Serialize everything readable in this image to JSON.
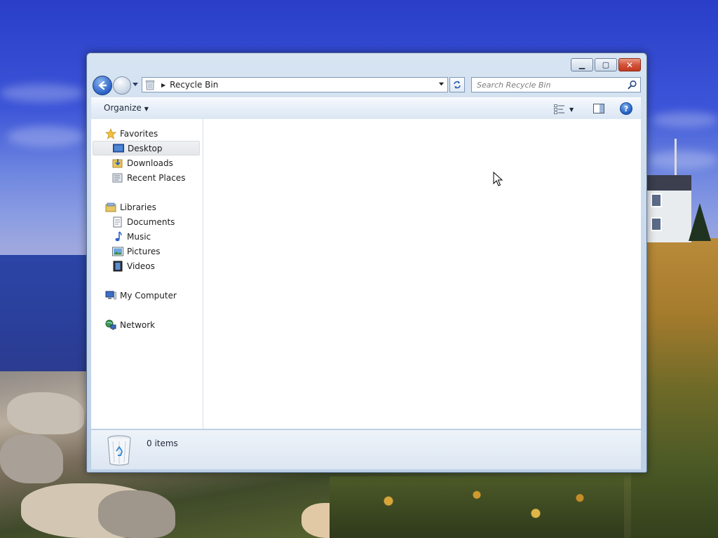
{
  "window": {
    "caption_buttons": {
      "minimize": "▁",
      "maximize": "▢",
      "close": "✕"
    }
  },
  "navigation": {
    "back_icon": "arrow-left-icon",
    "forward_icon": "arrow-right-icon",
    "address": {
      "location": "Recycle Bin",
      "icon": "recycle-bin-icon"
    },
    "search": {
      "placeholder": "Search Recycle Bin"
    }
  },
  "toolbar": {
    "organize_label": "Organize",
    "views_icon": "views-icon",
    "preview_icon": "preview-pane-icon",
    "help_label": "?"
  },
  "nav_pane": {
    "favorites": {
      "label": "Favorites",
      "items": [
        {
          "label": "Desktop",
          "selected": true
        },
        {
          "label": "Downloads"
        },
        {
          "label": "Recent Places"
        }
      ]
    },
    "libraries": {
      "label": "Libraries",
      "items": [
        {
          "label": "Documents"
        },
        {
          "label": "Music"
        },
        {
          "label": "Pictures"
        },
        {
          "label": "Videos"
        }
      ]
    },
    "computer": {
      "label": "My Computer"
    },
    "network": {
      "label": "Network"
    }
  },
  "details_pane": {
    "item_count": "0 items"
  },
  "colors": {
    "accent": "#2a62c8",
    "close": "#d4533a"
  }
}
